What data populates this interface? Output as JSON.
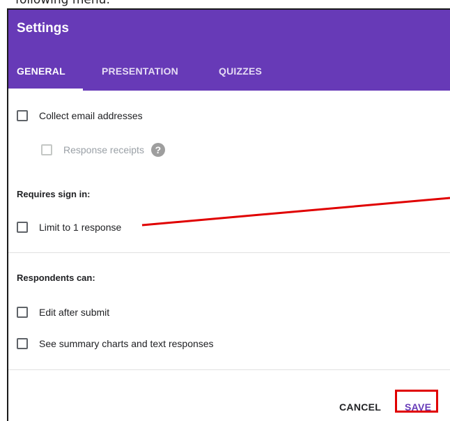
{
  "intro_text": "following menu:",
  "dialog": {
    "title": "Settings",
    "tabs": [
      {
        "label": "GENERAL",
        "active": true
      },
      {
        "label": "PRESENTATION",
        "active": false
      },
      {
        "label": "QUIZZES",
        "active": false
      }
    ],
    "options": {
      "collect_email": {
        "label": "Collect email addresses",
        "checked": false
      },
      "response_receipts": {
        "label": "Response receipts",
        "checked": false,
        "disabled": true,
        "help_icon": "help-icon"
      }
    },
    "sections": {
      "sign_in": {
        "heading": "Requires sign in:",
        "limit_one": {
          "label": "Limit to 1 response",
          "checked": false
        }
      },
      "respondents": {
        "heading": "Respondents can:",
        "edit_after_submit": {
          "label": "Edit after submit",
          "checked": false
        },
        "see_summary": {
          "label": "See summary charts and text responses",
          "checked": false
        }
      }
    },
    "actions": {
      "cancel_label": "CANCEL",
      "save_label": "SAVE"
    }
  },
  "colors": {
    "header": "#673ab7",
    "annotation": "#e00000",
    "save_text": "#673ab7"
  }
}
